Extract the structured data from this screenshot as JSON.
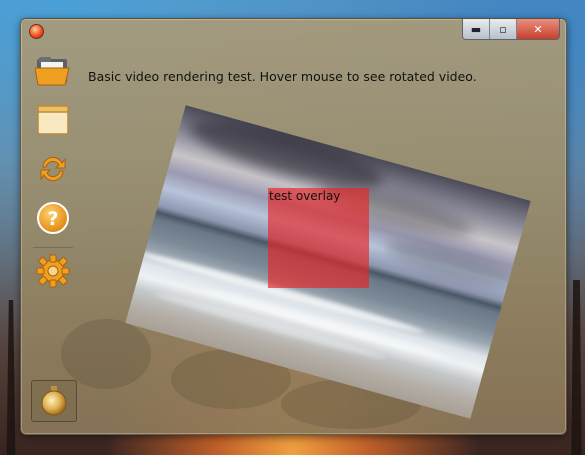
{
  "window": {
    "controls": {
      "minimize_icon": "minimize-icon",
      "maximize_icon": "maximize-icon",
      "close_icon": "close-icon",
      "minimize_glyph": "▬",
      "maximize_glyph": "▫",
      "close_glyph": "✕"
    }
  },
  "sidebar": {
    "items": [
      {
        "icon": "folder-open-icon"
      },
      {
        "icon": "window-icon"
      },
      {
        "icon": "refresh-icon"
      },
      {
        "icon": "help-icon",
        "glyph": "?"
      },
      {
        "icon": "gear-icon"
      }
    ],
    "bottom_item": {
      "icon": "orb-icon"
    }
  },
  "main": {
    "instruction": "Basic video rendering test. Hover mouse to see rotated video.",
    "video": {
      "overlay_label": "test overlay",
      "overlay_color": "#e82424",
      "rotation_degrees": 15.5
    }
  },
  "colors": {
    "window_tint": "#a89b78",
    "accent_orange": "#f0a020"
  }
}
